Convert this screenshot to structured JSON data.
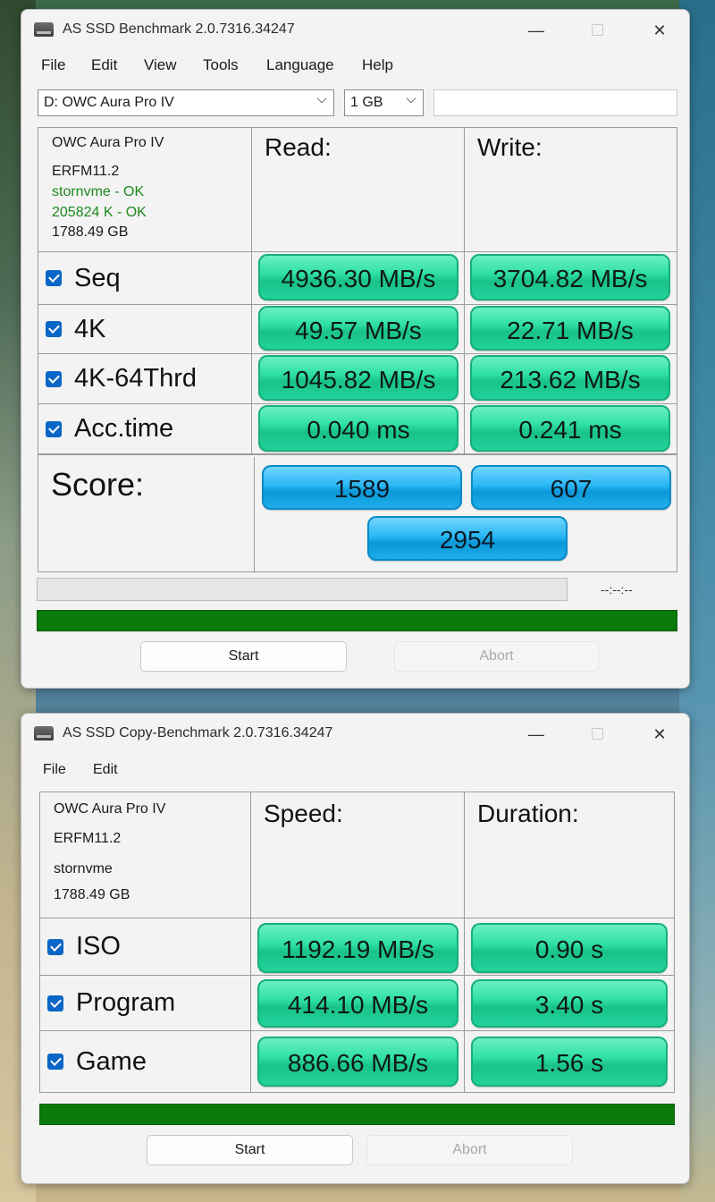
{
  "benchmark": {
    "title": "AS SSD Benchmark 2.0.7316.34247",
    "menu": [
      "File",
      "Edit",
      "View",
      "Tools",
      "Language",
      "Help"
    ],
    "drive_select": "D: OWC Aura Pro IV",
    "size_select": "1 GB",
    "info": {
      "model": "OWC Aura Pro IV",
      "firmware": "ERFM11.2",
      "driver": "stornvme - OK",
      "alignment": "205824 K - OK",
      "capacity": "1788.49 GB"
    },
    "headers": {
      "read": "Read:",
      "write": "Write:"
    },
    "rows": [
      {
        "label": "Seq",
        "read": "4936.30 MB/s",
        "write": "3704.82 MB/s",
        "checked": true
      },
      {
        "label": "4K",
        "read": "49.57 MB/s",
        "write": "22.71 MB/s",
        "checked": true
      },
      {
        "label": "4K-64Thrd",
        "read": "1045.82 MB/s",
        "write": "213.62 MB/s",
        "checked": true
      },
      {
        "label": "Acc.time",
        "read": "0.040 ms",
        "write": "0.241 ms",
        "checked": true
      }
    ],
    "score": {
      "label": "Score:",
      "read": "1589",
      "write": "607",
      "total": "2954"
    },
    "timer": "--:--:--",
    "progress": 1.0,
    "start_label": "Start",
    "abort_label": "Abort"
  },
  "copy": {
    "title": "AS SSD Copy-Benchmark 2.0.7316.34247",
    "menu": [
      "File",
      "Edit"
    ],
    "info": {
      "model": "OWC Aura Pro IV",
      "firmware": "ERFM11.2",
      "driver": "stornvme",
      "capacity": "1788.49 GB"
    },
    "headers": {
      "speed": "Speed:",
      "duration": "Duration:"
    },
    "rows": [
      {
        "label": "ISO",
        "speed": "1192.19 MB/s",
        "duration": "0.90 s",
        "checked": true
      },
      {
        "label": "Program",
        "speed": "414.10 MB/s",
        "duration": "3.40 s",
        "checked": true
      },
      {
        "label": "Game",
        "speed": "886.66 MB/s",
        "duration": "1.56 s",
        "checked": true
      }
    ],
    "progress": 1.0,
    "start_label": "Start",
    "abort_label": "Abort"
  },
  "icons": {
    "app": "hard-drive-icon",
    "minimize": "minimize-icon",
    "maximize": "maximize-icon",
    "close": "close-icon",
    "checkbox": "checkbox-checked-icon",
    "dropdown": "chevron-down-icon"
  },
  "colors": {
    "result_pill": "#2fe0a6",
    "score_pill": "#2ab7f5",
    "progress_bar": "#0a7a0a",
    "info_ok": "#1d8a1d"
  }
}
